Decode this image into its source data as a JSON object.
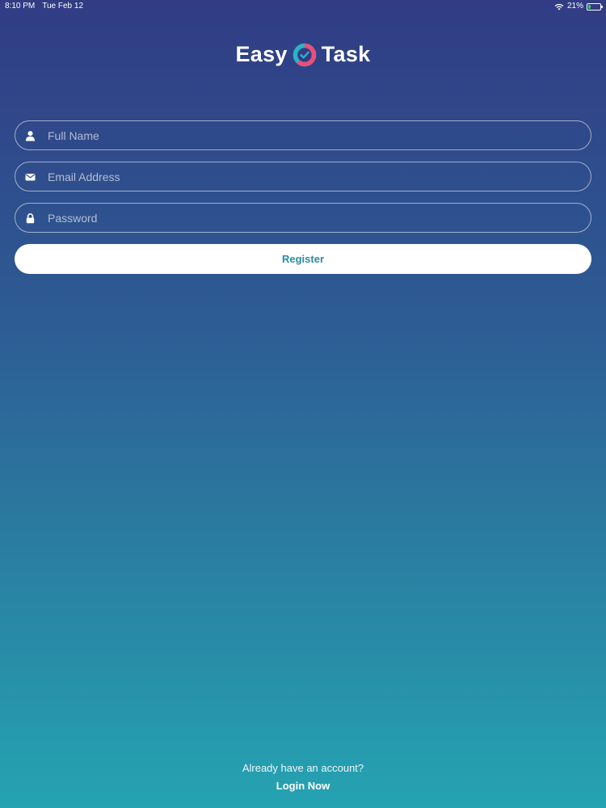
{
  "status_bar": {
    "time": "8:10 PM",
    "date": "Tue Feb 12",
    "battery_percent": "21%",
    "battery_level": 0.21,
    "wifi_icon": "wifi-icon",
    "battery_icon": "battery-charging-icon"
  },
  "logo": {
    "word_left": "Easy",
    "word_right": "Task",
    "mark_icon": "check-circle-icon"
  },
  "form": {
    "full_name": {
      "placeholder": "Full Name",
      "value": "",
      "icon": "user-icon"
    },
    "email": {
      "placeholder": "Email Address",
      "value": "",
      "icon": "envelope-icon"
    },
    "password": {
      "placeholder": "Password",
      "value": "",
      "icon": "lock-icon"
    },
    "register_label": "Register"
  },
  "footer": {
    "prompt": "Already have an account?",
    "login_label": "Login Now"
  },
  "colors": {
    "gradient_top": "#313c84",
    "gradient_bottom": "#25a3b2",
    "button_text": "#2a8aa0",
    "logo_ring_pink": "#e8507a",
    "logo_ring_teal": "#2bb3c4",
    "battery_green": "#34c759"
  }
}
